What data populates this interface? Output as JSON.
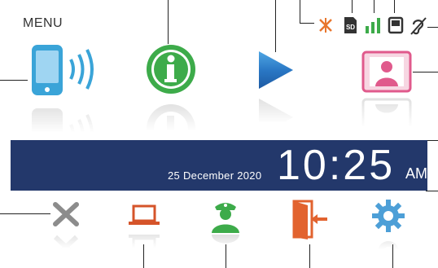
{
  "menu": {
    "title": "MENU"
  },
  "status_icons": [
    {
      "name": "no-connection-icon",
      "color": "#e8762d"
    },
    {
      "name": "sd-card-icon",
      "label": "SD",
      "color": "#333333"
    },
    {
      "name": "signal-strength-icon",
      "color": "#3dab4a"
    },
    {
      "name": "memory-card-icon",
      "color": "#333333"
    },
    {
      "name": "hearing-loop-icon",
      "color": "#333333"
    }
  ],
  "apps": [
    {
      "name": "intercom-icon",
      "color": "#3aa4d8"
    },
    {
      "name": "information-icon",
      "color": "#3dab4a"
    },
    {
      "name": "playback-icon",
      "color": "#2a78c5"
    },
    {
      "name": "contacts-icon",
      "color": "#e05a8c"
    }
  ],
  "clock": {
    "date": "25 December 2020",
    "time": "10:25",
    "ampm": "AM",
    "band_color": "#23386b"
  },
  "bottom_bar": [
    {
      "name": "close-icon",
      "color": "#8c8c8c"
    },
    {
      "name": "laptop-icon",
      "color": "#d5542a"
    },
    {
      "name": "concierge-icon",
      "color": "#3dab4a"
    },
    {
      "name": "exit-door-icon",
      "color": "#e2632f"
    },
    {
      "name": "settings-gear-icon",
      "color": "#4d9fd7"
    }
  ]
}
